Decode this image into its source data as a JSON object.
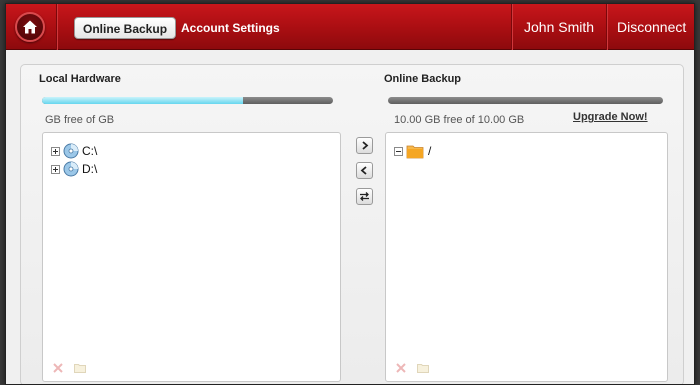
{
  "header": {
    "tabs": [
      {
        "label": "Online Backup",
        "active": true
      },
      {
        "label": "Account Settings",
        "active": false
      }
    ],
    "user_name": "John Smith",
    "disconnect_label": "Disconnect"
  },
  "local": {
    "title": "Local Hardware",
    "usage_fraction": 0.69,
    "space_text": "GB free of   GB",
    "drives": [
      {
        "label": "C:\\",
        "icon": "drive-icon"
      },
      {
        "label": "D:\\",
        "icon": "drive-icon"
      }
    ]
  },
  "online": {
    "title": "Online Backup",
    "usage_fraction": 0.0,
    "space_text": "10.00  GB free of  10.00  GB",
    "upgrade_label": "Upgrade Now!",
    "root": {
      "label": "/",
      "icon": "folder-icon"
    }
  },
  "transfer_buttons": [
    {
      "name": "upload-button",
      "icon": "chevron-right-icon"
    },
    {
      "name": "download-button",
      "icon": "chevron-left-icon"
    },
    {
      "name": "sync-button",
      "icon": "sync-icon"
    }
  ],
  "colors": {
    "header_red": "#b31217",
    "usage_fill": "#66d6ee",
    "folder_orange": "#f5a623"
  }
}
